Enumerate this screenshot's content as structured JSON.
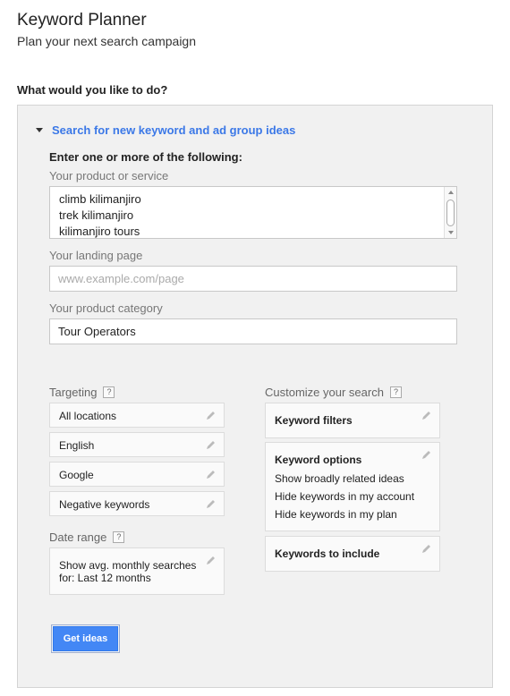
{
  "header": {
    "title": "Keyword Planner",
    "subtitle": "Plan your next search campaign",
    "question": "What would you like to do?"
  },
  "search_section": {
    "title": "Search for new keyword and ad group ideas",
    "instruction": "Enter one or more of the following:",
    "product_label": "Your product or service",
    "product_lines": [
      "climb kilimanjiro",
      "trek kilimanjiro",
      "kilimanjiro tours"
    ],
    "landing_label": "Your landing page",
    "landing_placeholder": "www.example.com/page",
    "category_label": "Your product category",
    "category_value": "Tour Operators"
  },
  "targeting": {
    "label": "Targeting",
    "help": "?",
    "items": [
      {
        "label": "All locations"
      },
      {
        "label": "English"
      },
      {
        "label": "Google"
      },
      {
        "label": "Negative keywords"
      }
    ]
  },
  "date_range": {
    "label": "Date range",
    "help": "?",
    "line1": "Show avg. monthly searches",
    "line2": "for: Last 12 months"
  },
  "customize": {
    "label": "Customize your search",
    "help": "?",
    "keyword_filters": "Keyword filters",
    "keyword_options": {
      "title": "Keyword options",
      "options": [
        "Show broadly related ideas",
        "Hide keywords in my account",
        "Hide keywords in my plan"
      ]
    },
    "keywords_to_include": "Keywords to include"
  },
  "actions": {
    "get_ideas": "Get ideas"
  },
  "icons": {
    "edit": "pencil-icon",
    "collapse": "triangle-down-icon",
    "help": "help-icon"
  },
  "colors": {
    "accent": "#3b78e7",
    "button": "#4387f5",
    "panel": "#f1f1f1"
  }
}
